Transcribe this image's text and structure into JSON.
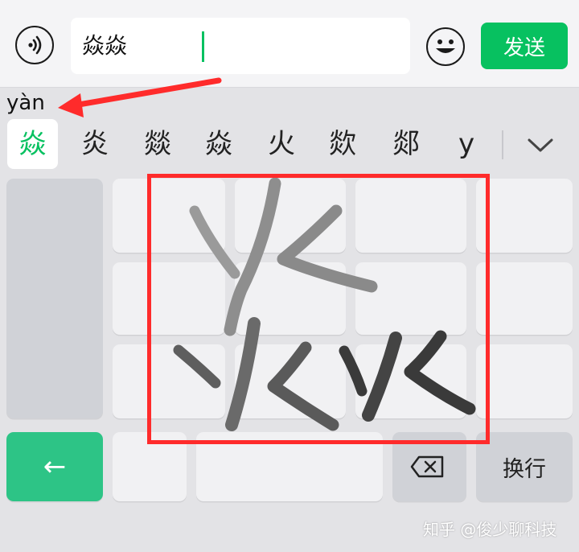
{
  "input": {
    "text": "焱焱"
  },
  "toolbar": {
    "send_label": "发送"
  },
  "ime": {
    "pinyin": "yàn",
    "candidates": [
      "焱",
      "炎",
      "燚",
      "焱",
      "火",
      "欻",
      "郯",
      "y"
    ],
    "selected_index": 0
  },
  "keys": {
    "newline_label": "换行",
    "back_arrow": "←"
  },
  "watermark": "知乎 @俊少聊科技",
  "colors": {
    "accent": "#07c160",
    "annotation": "#ff2b2b",
    "back_key": "#2dc486"
  }
}
